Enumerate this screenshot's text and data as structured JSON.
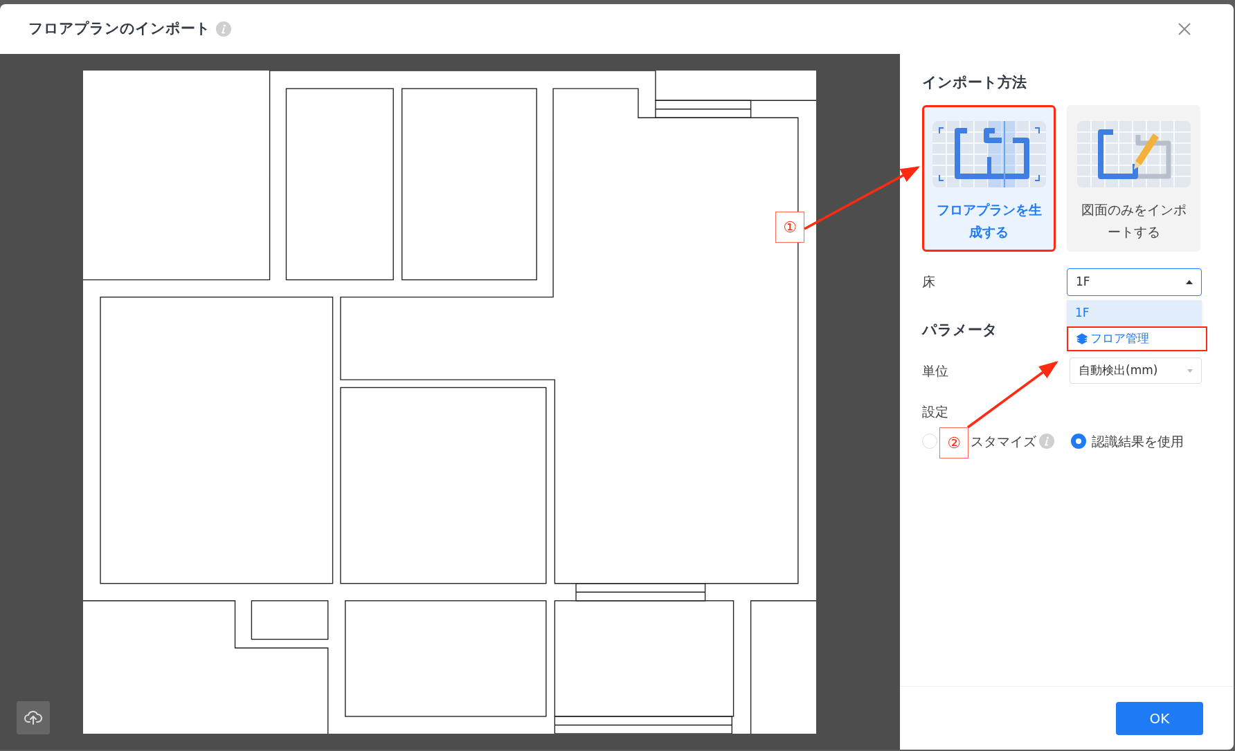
{
  "dialog": {
    "title": "フロアプランのインポート"
  },
  "annotations": [
    {
      "label": "①"
    },
    {
      "label": "②"
    }
  ],
  "import_method": {
    "heading": "インポート方法",
    "options": [
      {
        "label": "フロアプランを生成する",
        "selected": true
      },
      {
        "label": "図面のみをインポートする",
        "selected": false
      }
    ]
  },
  "floor": {
    "label": "床",
    "value": "1F",
    "expanded": true,
    "options": [
      {
        "label": "1F",
        "selected": true
      }
    ],
    "manage_link": "フロア管理"
  },
  "parameters": {
    "heading": "パラメータ",
    "unit": {
      "label": "単位",
      "value": "自動検出(mm)"
    },
    "settings": {
      "label": "設定",
      "options": [
        {
          "label": "スタマイズ",
          "selected": false,
          "info": true
        },
        {
          "label": "認識結果を使用",
          "selected": true
        }
      ]
    }
  },
  "footer": {
    "ok": "OK"
  }
}
